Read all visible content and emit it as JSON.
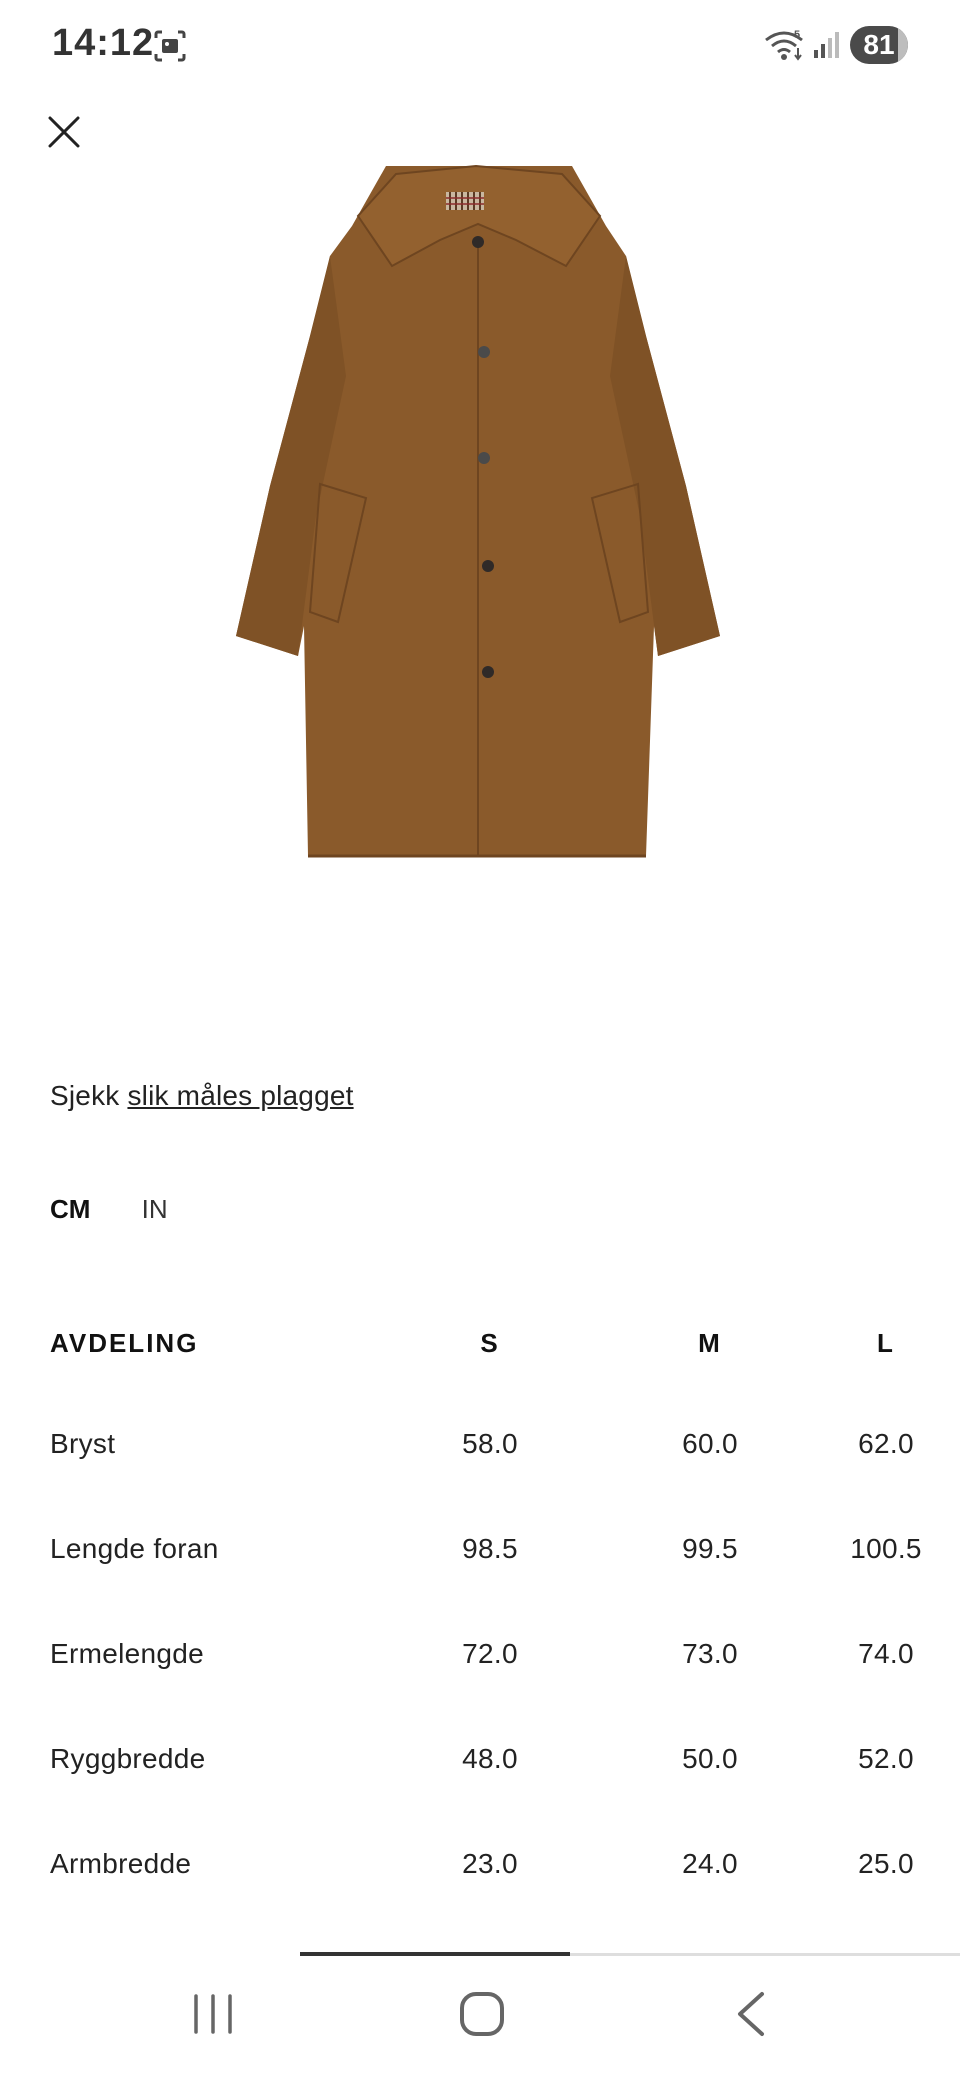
{
  "status_bar": {
    "time": "14:12",
    "battery_level": "81",
    "icons": [
      "screenshot-icon",
      "wifi-icon",
      "signal-icon",
      "battery-icon"
    ]
  },
  "product": {
    "image_icon": "coat-image",
    "coat_color": "#8a5a2b"
  },
  "measure": {
    "prefix": "Sjekk ",
    "link_text": "slik måles plagget"
  },
  "units": {
    "cm": "CM",
    "in": "IN",
    "selected": "CM"
  },
  "table": {
    "headers": {
      "label": "AVDELING",
      "s": "S",
      "m": "M",
      "l": "L"
    },
    "rows": [
      {
        "label": "Bryst",
        "s": "58.0",
        "m": "60.0",
        "l": "62.0"
      },
      {
        "label": "Lengde foran",
        "s": "98.5",
        "m": "99.5",
        "l": "100.5"
      },
      {
        "label": "Ermelengde",
        "s": "72.0",
        "m": "73.0",
        "l": "74.0"
      },
      {
        "label": "Ryggbredde",
        "s": "48.0",
        "m": "50.0",
        "l": "52.0"
      },
      {
        "label": "Armbredde",
        "s": "23.0",
        "m": "24.0",
        "l": "25.0"
      }
    ]
  },
  "nav": {
    "icons": [
      "recents-icon",
      "home-icon",
      "back-icon"
    ]
  }
}
